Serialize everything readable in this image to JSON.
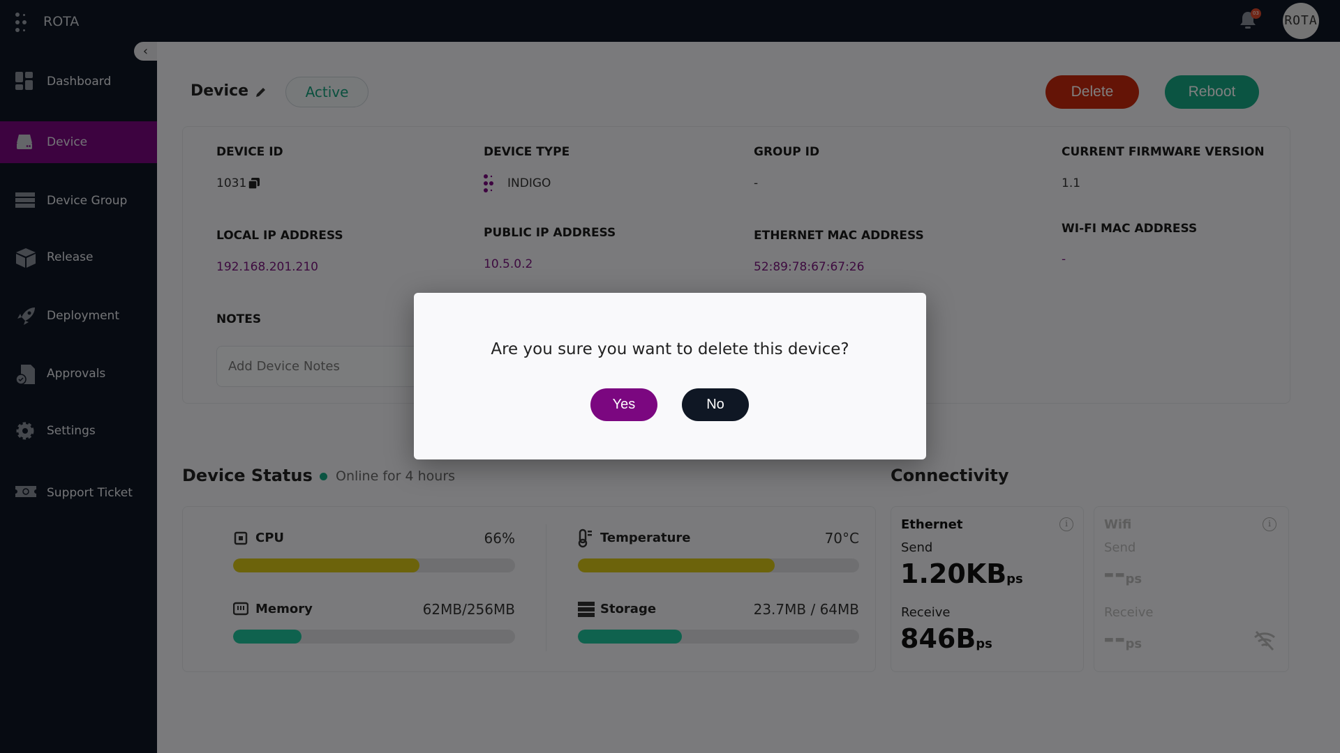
{
  "app": {
    "brand": "ROTA",
    "notifications_count": "03",
    "avatar_text": "ROTA"
  },
  "sidebar": {
    "items": [
      {
        "label": "Dashboard",
        "icon": "dashboard-icon"
      },
      {
        "label": "Device",
        "icon": "hard-drive-icon",
        "active": true
      },
      {
        "label": "Device Group",
        "icon": "server-rack-icon"
      },
      {
        "label": "Release",
        "icon": "box-icon"
      },
      {
        "label": "Deployment",
        "icon": "rocket-icon"
      },
      {
        "label": "Approvals",
        "icon": "document-check-icon"
      },
      {
        "label": "Settings",
        "icon": "gear-icon"
      },
      {
        "label": "Support Ticket",
        "icon": "ticket-icon"
      }
    ]
  },
  "header": {
    "title": "Device",
    "status": "Active",
    "delete_label": "Delete",
    "reboot_label": "Reboot"
  },
  "details": {
    "device_id": {
      "label": "DEVICE ID",
      "value": "1031"
    },
    "device_type": {
      "label": "DEVICE TYPE",
      "value": "INDIGO"
    },
    "group_id": {
      "label": "GROUP ID",
      "value": "-"
    },
    "firmware": {
      "label": "CURRENT FIRMWARE VERSION",
      "value": "1.1"
    },
    "local_ip": {
      "label": "LOCAL IP ADDRESS",
      "value": "192.168.201.210"
    },
    "public_ip": {
      "label": "PUBLIC IP ADDRESS",
      "value": "10.5.0.2"
    },
    "eth_mac": {
      "label": "ETHERNET MAC ADDRESS",
      "value": "52:89:78:67:67:26"
    },
    "wifi_mac": {
      "label": "WI-FI MAC ADDRESS",
      "value": "-"
    },
    "notes": {
      "label": "NOTES",
      "placeholder": "Add Device Notes"
    }
  },
  "status": {
    "title": "Device Status",
    "online": "Online for 4 hours",
    "metrics": [
      {
        "label": "CPU",
        "value": "66%",
        "fraction": 0.66,
        "color": "#d8c716"
      },
      {
        "label": "Temperature",
        "value": "70°C",
        "fraction": 0.7,
        "color": "#d8c716"
      },
      {
        "label": "Memory",
        "value": "62MB/256MB",
        "fraction": 0.242,
        "color": "#1ec49c"
      },
      {
        "label": "Storage",
        "value": "23.7MB / 64MB",
        "fraction": 0.37,
        "color": "#1ec49c"
      }
    ]
  },
  "connectivity": {
    "title": "Connectivity",
    "ethernet": {
      "label": "Ethernet",
      "send_label": "Send",
      "send_value": "1.20KB",
      "receive_label": "Receive",
      "receive_value": "846B",
      "unit": "ps"
    },
    "wifi": {
      "label": "Wifi",
      "send_label": "Send",
      "send_value": "--",
      "receive_label": "Receive",
      "receive_value": "--",
      "unit": "ps"
    }
  },
  "modal": {
    "question": "Are you sure you want to delete this device?",
    "yes_label": "Yes",
    "no_label": "No"
  },
  "colors": {
    "accent": "#7b0780",
    "danger": "#c8290c",
    "success": "#17a884",
    "dark": "#0f1724"
  }
}
